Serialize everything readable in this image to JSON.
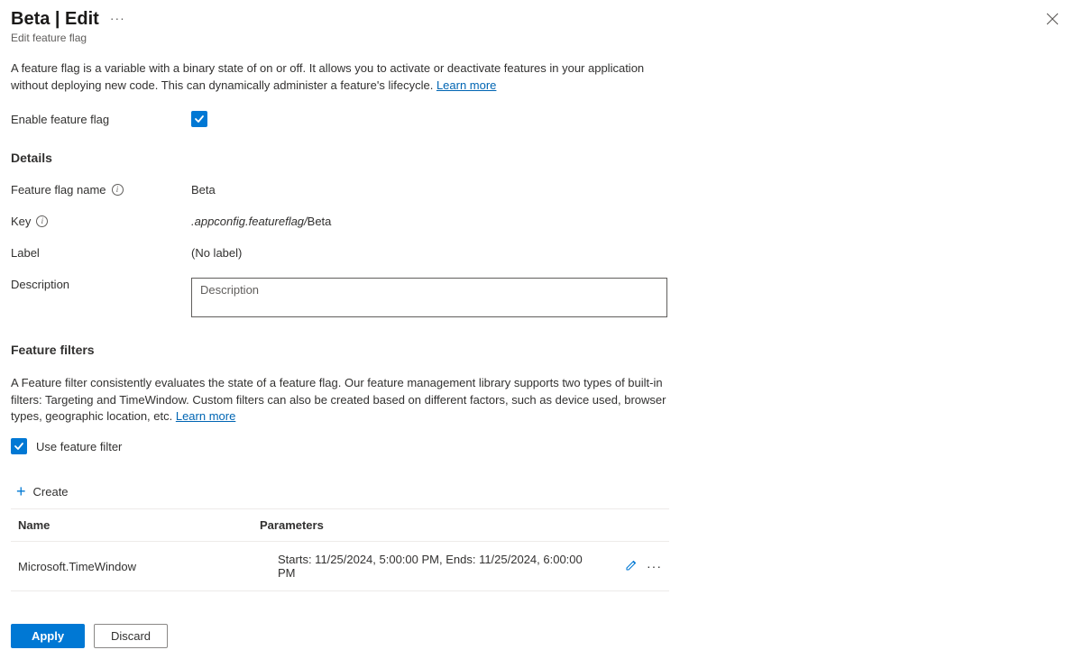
{
  "header": {
    "title": "Beta | Edit",
    "subtitle": "Edit feature flag"
  },
  "intro": {
    "text": "A feature flag is a variable with a binary state of on or off. It allows you to activate or deactivate features in your application without deploying new code. This can dynamically administer a feature's lifecycle. ",
    "learn_more": "Learn more"
  },
  "enable": {
    "label": "Enable feature flag",
    "checked": true
  },
  "details": {
    "heading": "Details",
    "name_label": "Feature flag name",
    "name_value": "Beta",
    "key_label": "Key",
    "key_prefix": ".appconfig.featureflag/",
    "key_suffix": "Beta",
    "label_label": "Label",
    "label_value": "(No label)",
    "description_label": "Description",
    "description_placeholder": "Description",
    "description_value": ""
  },
  "filters": {
    "heading": "Feature filters",
    "intro_text": "A Feature filter consistently evaluates the state of a feature flag. Our feature management library supports two types of built-in filters: Targeting and TimeWindow. Custom filters can also be created based on different factors, such as device used, browser types, geographic location, etc. ",
    "learn_more": "Learn more",
    "use_filter_label": "Use feature filter",
    "use_filter_checked": true,
    "create_label": "Create",
    "table": {
      "col_name": "Name",
      "col_params": "Parameters",
      "rows": [
        {
          "name": "Microsoft.TimeWindow",
          "params": "Starts: 11/25/2024, 5:00:00 PM, Ends: 11/25/2024, 6:00:00 PM"
        }
      ]
    }
  },
  "footer": {
    "apply": "Apply",
    "discard": "Discard"
  }
}
